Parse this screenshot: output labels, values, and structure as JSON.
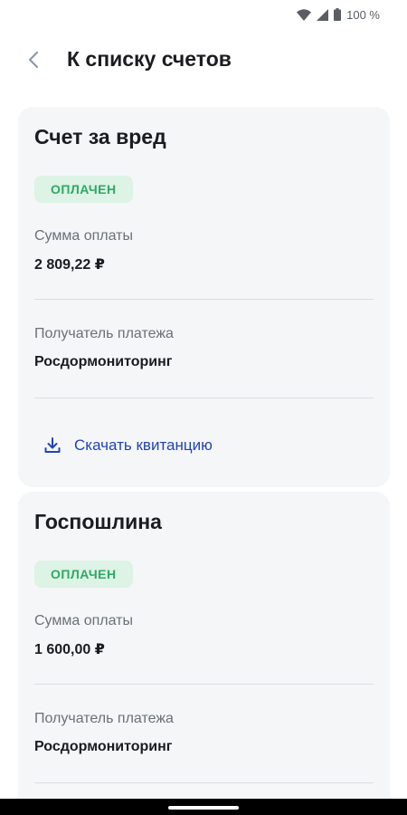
{
  "status_bar": {
    "battery_text": "100 %",
    "icons": [
      "wifi-icon",
      "signal-icon",
      "battery-icon"
    ]
  },
  "header": {
    "back_icon": "chevron-left-icon",
    "title": "К списку счетов"
  },
  "invoices": [
    {
      "title": "Счет за вред",
      "status": "ОПЛАЧЕН",
      "amount_label": "Сумма оплаты",
      "amount": "2 809,22 ₽",
      "recipient_label": "Получатель платежа",
      "recipient": "Росдормониторинг",
      "download_label": "Скачать квитанцию",
      "download_icon": "download-icon"
    },
    {
      "title": "Госпошлина",
      "status": "ОПЛАЧЕН",
      "amount_label": "Сумма оплаты",
      "amount": "1 600,00 ₽",
      "recipient_label": "Получатель платежа",
      "recipient": "Росдормониторинг"
    }
  ],
  "colors": {
    "accent": "#2343b8",
    "status_paid_bg": "#dcf3e5",
    "status_paid_text": "#2fa866",
    "card_bg": "#f4f6f8"
  }
}
